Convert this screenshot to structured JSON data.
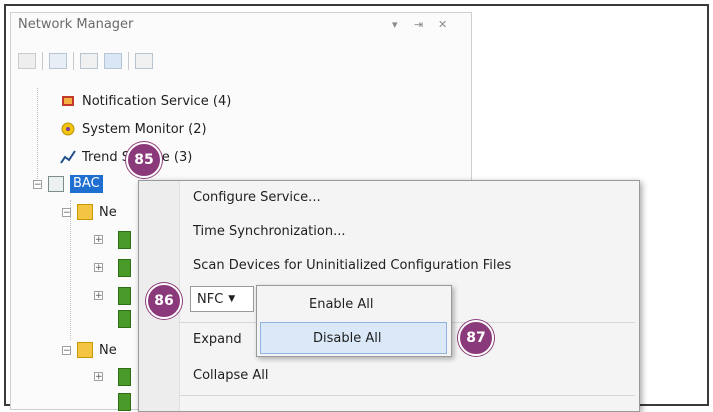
{
  "panel": {
    "title": "Network Manager",
    "title_controls": [
      "▾",
      "⇥",
      "✕"
    ]
  },
  "tree": {
    "items": [
      {
        "label": "Notification Service (4)",
        "icon": "notification-service-icon"
      },
      {
        "label": "System Monitor (2)",
        "icon": "system-monitor-icon"
      },
      {
        "label": "Trend Service (3)",
        "icon": "trend-service-icon"
      },
      {
        "label": "BAC",
        "icon": "bacnet-icon",
        "selected": true
      },
      {
        "label": "Ne",
        "icon": "network-folder-icon"
      },
      {
        "label": "Ne",
        "icon": "network-folder-icon"
      }
    ]
  },
  "context_menu": {
    "items": [
      "Configure Service...",
      "Time Synchronization...",
      "Scan Devices for Uninitialized Configuration Files",
      "Expand",
      "Collapse All"
    ],
    "nfc_label": "NFC"
  },
  "submenu": {
    "items": [
      "Enable All",
      "Disable All"
    ],
    "highlighted_index": 1
  },
  "callouts": [
    "85",
    "86",
    "87"
  ],
  "colors": {
    "callout": "#8a3a7a",
    "selection": "#1e6fd0",
    "highlight": "#dbe8f7"
  }
}
